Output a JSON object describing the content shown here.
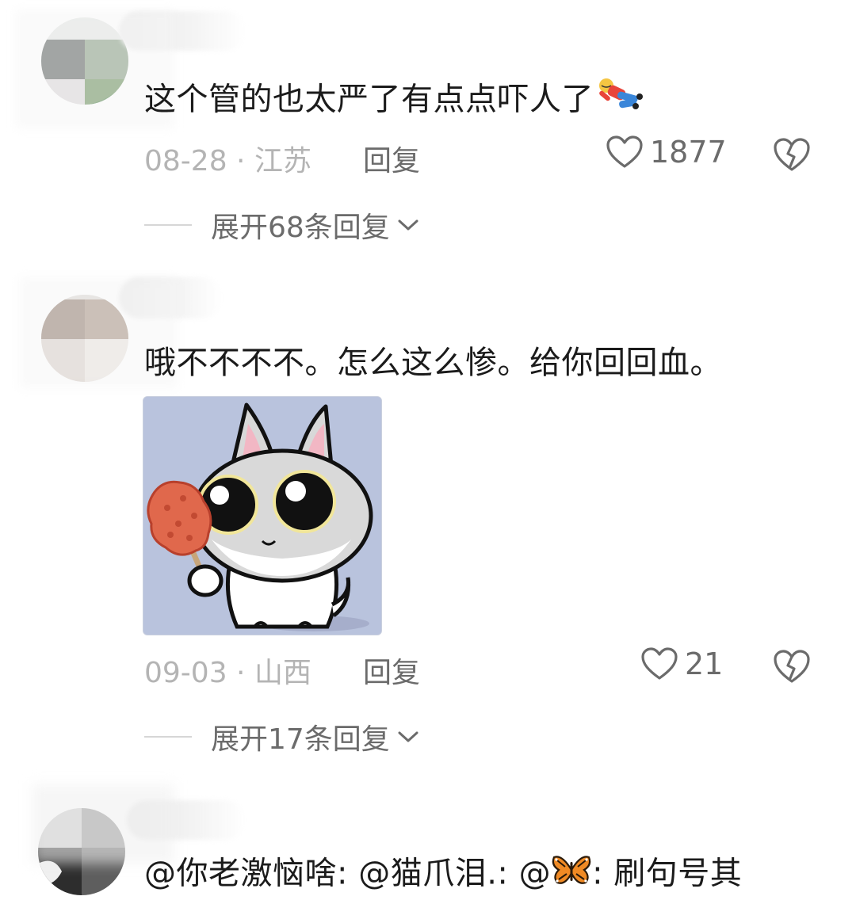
{
  "comments": [
    {
      "text": "这个管的也太严了有点点吓人了",
      "emoji": "fallen-person-emoji",
      "date": "08-28",
      "separator": " · ",
      "region": "江苏",
      "reply_label": "回复",
      "likes": "1877",
      "expand_label": "展开68条回复"
    },
    {
      "text": "哦不不不不。怎么这么惨。给你回回血。",
      "sticker": "cat-holding-fried-chicken-sticker",
      "date": "09-03",
      "separator": " · ",
      "region": "山西",
      "reply_label": "回复",
      "likes": "21",
      "expand_label": "展开17条回复"
    },
    {
      "text_part1": "@你老激恼啥: @猫爪泪.: @",
      "emoji": "butterfly-emoji",
      "text_part2": ": 刷句号其"
    }
  ],
  "colors": {
    "meta_gray": "#b4b4b4",
    "action_gray": "#6b6b6b",
    "text": "#1b1b1b",
    "sticker_bg": "#b9c3dd"
  }
}
